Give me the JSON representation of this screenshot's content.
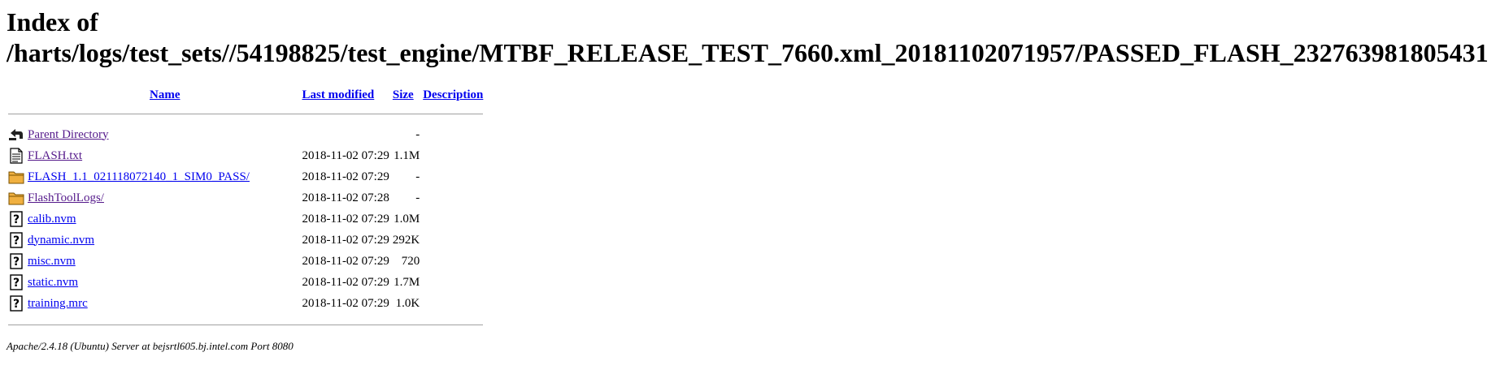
{
  "page": {
    "title_line1": "Index of",
    "title_line2": "/harts/logs/test_sets//54198825/test_engine/MTBF_RELEASE_TEST_7660.xml_20181102071957/PASSED_FLASH_232763981805431"
  },
  "table": {
    "headers": {
      "name": "Name",
      "last_modified": "Last modified",
      "size": "Size",
      "description": "Description"
    },
    "rows": [
      {
        "icon": "back-icon",
        "name": "Parent Directory",
        "modified": "",
        "size": "-",
        "visited": true
      },
      {
        "icon": "text-file-icon",
        "name": "FLASH.txt",
        "modified": "2018-11-02 07:29",
        "size": "1.1M",
        "visited": true
      },
      {
        "icon": "folder-icon",
        "name": "FLASH_1.1_021118072140_1_SIM0_PASS/",
        "modified": "2018-11-02 07:29",
        "size": "-",
        "visited": false
      },
      {
        "icon": "folder-icon",
        "name": "FlashToolLogs/",
        "modified": "2018-11-02 07:28",
        "size": "-",
        "visited": true
      },
      {
        "icon": "unknown-file-icon",
        "name": "calib.nvm",
        "modified": "2018-11-02 07:29",
        "size": "1.0M",
        "visited": false
      },
      {
        "icon": "unknown-file-icon",
        "name": "dynamic.nvm",
        "modified": "2018-11-02 07:29",
        "size": "292K",
        "visited": false
      },
      {
        "icon": "unknown-file-icon",
        "name": "misc.nvm",
        "modified": "2018-11-02 07:29",
        "size": "720",
        "visited": false
      },
      {
        "icon": "unknown-file-icon",
        "name": "static.nvm",
        "modified": "2018-11-02 07:29",
        "size": "1.7M",
        "visited": false
      },
      {
        "icon": "unknown-file-icon",
        "name": "training.mrc",
        "modified": "2018-11-02 07:29",
        "size": "1.0K",
        "visited": false
      }
    ]
  },
  "footer": {
    "address": "Apache/2.4.18 (Ubuntu) Server at bejsrtl605.bj.intel.com Port 8080"
  },
  "colors": {
    "link": "#0000ee",
    "visited_link": "#551a8b",
    "rule": "#a0a0a0",
    "folder": "#f0b040"
  }
}
